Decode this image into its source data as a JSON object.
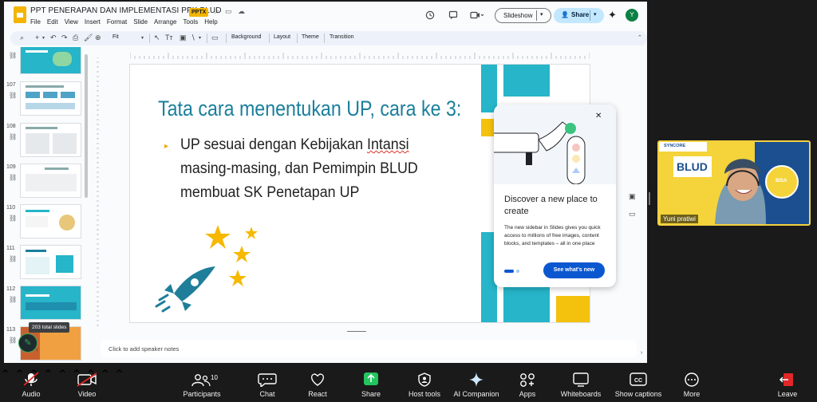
{
  "document": {
    "title": "PPT PENERAPAN DAN IMPLEMENTASI PPK BLUD",
    "format_badge": "PPTX",
    "menus": [
      "File",
      "Edit",
      "View",
      "Insert",
      "Format",
      "Slide",
      "Arrange",
      "Tools",
      "Help"
    ],
    "slideshow_label": "Slideshow",
    "share_label": "Share",
    "user_initial": "Y"
  },
  "toolbar": {
    "zoom_value": "Fit",
    "background_label": "Background",
    "layout_label": "Layout",
    "theme_label": "Theme",
    "transition_label": "Transition"
  },
  "filmstrip": {
    "slide_numbers": [
      "107",
      "108",
      "109",
      "110",
      "111",
      "112",
      "113"
    ],
    "total_slides_badge": "203 total slides"
  },
  "slide": {
    "title": "Tata cara menentukan UP, cara ke 3:",
    "body_before": "UP sesuai dengan Kebijakan ",
    "body_squiggle": "Intansi",
    "body_after": " masing-masing, dan Pemimpin BLUD membuat SK Penetapan UP",
    "colors": {
      "title": "#1a7f9c",
      "teal": "#26b5c9",
      "yellow": "#f4c20d",
      "star": "#f6b800",
      "rocket": "#1f7e99"
    }
  },
  "speaker_notes_placeholder": "Click to add speaker notes",
  "promo": {
    "title": "Discover a new place to create",
    "body": "The new sidebar in Slides gives you quick access to millions of free images, content blocks, and templates – all in one place",
    "button_label": "See what's new"
  },
  "participant": {
    "name": "Yuni pratiwi",
    "bg_brand": "SYNCORE",
    "bg_title": "BLUD",
    "bg_badge": "BISA"
  },
  "zoom_controls": {
    "audio": "Audio",
    "video": "Video",
    "participants": "Participants",
    "participants_count": "10",
    "chat": "Chat",
    "react": "React",
    "share": "Share",
    "host_tools": "Host tools",
    "ai_companion": "AI Companion",
    "apps": "Apps",
    "whiteboards": "Whiteboards",
    "captions": "Show captions",
    "more": "More",
    "leave": "Leave"
  }
}
